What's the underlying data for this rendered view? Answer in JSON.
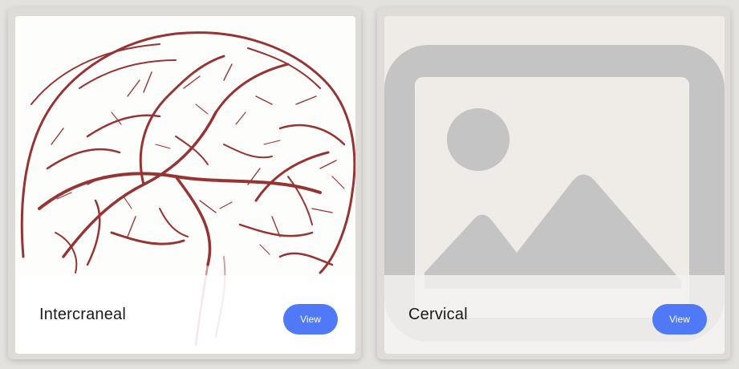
{
  "cards": [
    {
      "title": "Intercraneal",
      "button_label": "View",
      "image": "brain-vessels-image"
    },
    {
      "title": "Cervical",
      "button_label": "View",
      "image": "image-placeholder-icon"
    }
  ],
  "colors": {
    "button": "#4f79f6",
    "vessel": "#8e2323",
    "placeholder_gray": "#c4c4c4",
    "placeholder_bg": "#efebe6"
  }
}
